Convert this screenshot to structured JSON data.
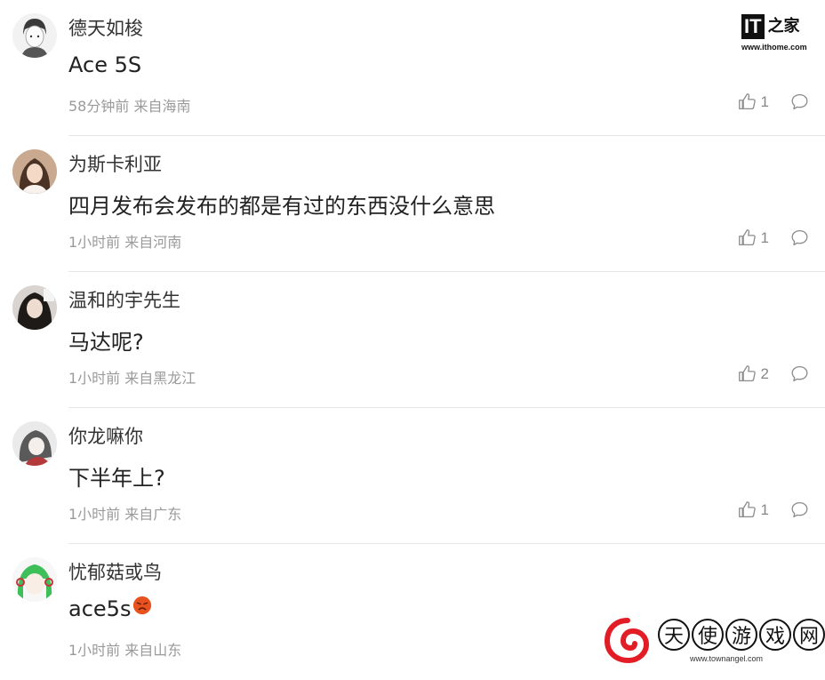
{
  "site_logo": {
    "mark": "IT",
    "mark_suffix": "之家",
    "url": "www.ithome.com"
  },
  "comments": [
    {
      "username": "德天如梭",
      "content": "Ace 5S",
      "time": "58分钟前",
      "location": "来自海南",
      "likes": "1",
      "avatar": "avatar-cartoon-boy"
    },
    {
      "username": "为斯卡利亚",
      "content": "四月发布会发布的都是有过的东西没什么意思",
      "time": "1小时前",
      "location": "来自河南",
      "likes": "1",
      "avatar": "avatar-girl-photo"
    },
    {
      "username": "温和的宇先生",
      "content": "马达呢?",
      "time": "1小时前",
      "location": "来自黑龙江",
      "likes": "2",
      "avatar": "avatar-woman-photo"
    },
    {
      "username": "你龙嘛你",
      "content": "下半年上?",
      "time": "1小时前",
      "location": "来自广东",
      "likes": "1",
      "avatar": "avatar-anime-girl"
    },
    {
      "username": "忧郁菇或鸟",
      "content": "ace5s",
      "time": "1小时前",
      "location": "来自山东",
      "likes": "",
      "avatar": "avatar-green-hair"
    }
  ],
  "watermark": {
    "text": "天使游戏网",
    "url": "www.townangel.com"
  },
  "colors": {
    "text": "#222222",
    "meta": "#9a9a9a",
    "divider": "#e6e6e6",
    "emoji": "#e8521f"
  }
}
